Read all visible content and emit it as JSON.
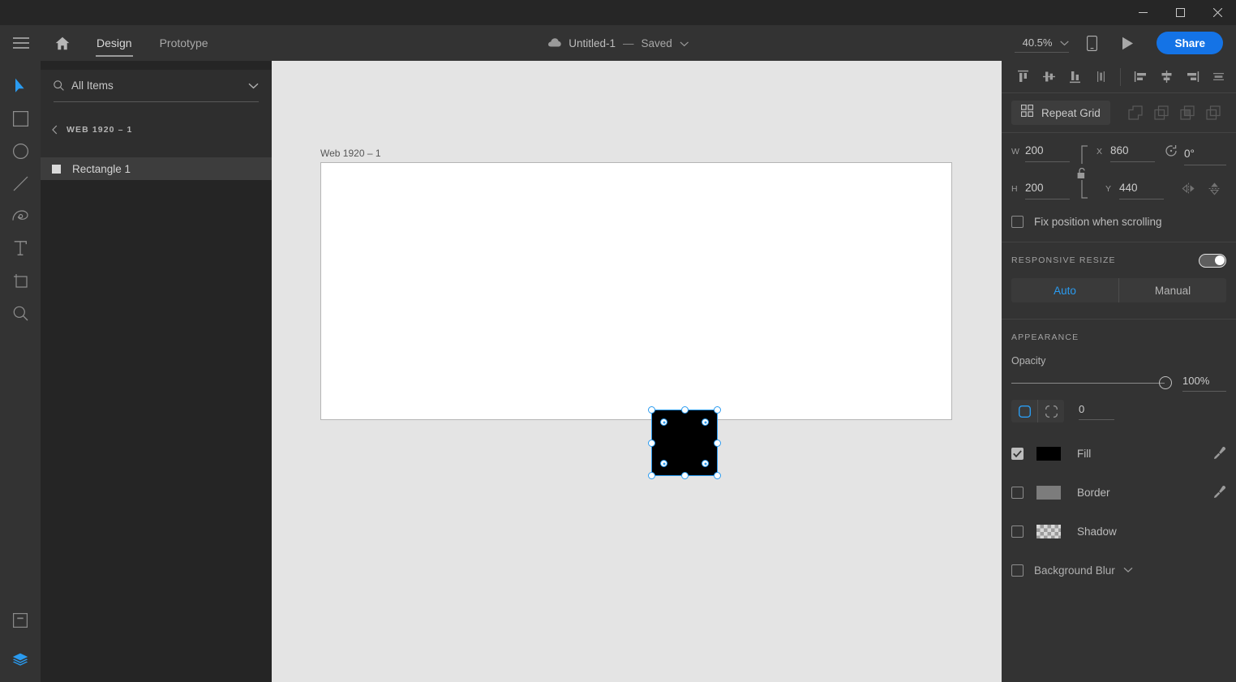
{
  "window": {
    "minimize_label": "Minimize",
    "maximize_label": "Maximize",
    "close_label": "Close"
  },
  "appbar": {
    "menu_label": "Menu",
    "home_label": "Home",
    "tabs": [
      {
        "label": "Design",
        "active": true
      },
      {
        "label": "Prototype",
        "active": false
      }
    ],
    "document": {
      "name": "Untitled-1",
      "separator": "—",
      "status": "Saved"
    },
    "zoom": "40.5%",
    "preview_label": "Preview on device",
    "play_label": "Desktop preview",
    "share_label": "Share"
  },
  "toolbar": {
    "tools": [
      {
        "name": "select-tool",
        "label": "Select",
        "active": true
      },
      {
        "name": "rectangle-tool",
        "label": "Rectangle",
        "active": false
      },
      {
        "name": "ellipse-tool",
        "label": "Ellipse",
        "active": false
      },
      {
        "name": "line-tool",
        "label": "Line",
        "active": false
      },
      {
        "name": "pen-tool",
        "label": "Pen",
        "active": false
      },
      {
        "name": "text-tool",
        "label": "Text",
        "active": false
      },
      {
        "name": "artboard-tool",
        "label": "Artboard",
        "active": false
      },
      {
        "name": "zoom-tool",
        "label": "Zoom",
        "active": false
      }
    ],
    "components_label": "Assets",
    "layers_label": "Layers"
  },
  "layers": {
    "search_placeholder": "All Items",
    "search_value": "All Items",
    "group_label": "WEB 1920 – 1",
    "items": [
      {
        "name": "Rectangle 1",
        "selected": true
      }
    ]
  },
  "canvas": {
    "artboard_name": "Web 1920 – 1",
    "background": "#e4e4e4",
    "artboard_fill": "#ffffff",
    "shape_fill": "#000000",
    "selection_color": "#2a9bf0"
  },
  "properties": {
    "align": {
      "vertical": [
        "align-top",
        "align-middle",
        "align-bottom",
        "distribute-vertical"
      ],
      "horizontal": [
        "align-left",
        "align-center",
        "align-right",
        "distribute-horizontal"
      ]
    },
    "repeat_grid_label": "Repeat Grid",
    "boolean_ops": [
      "add",
      "subtract",
      "intersect",
      "exclude"
    ],
    "transform": {
      "w_label": "W",
      "w_value": "200",
      "h_label": "H",
      "h_value": "200",
      "x_label": "X",
      "x_value": "860",
      "y_label": "Y",
      "y_value": "440",
      "rotation_value": "0°",
      "flip_horizontal_label": "Flip horizontally",
      "flip_vertical_label": "Flip vertically",
      "lock_aspect_label": "Lock aspect ratio"
    },
    "fix_position_label": "Fix position when scrolling",
    "fix_position_checked": false,
    "responsive_resize": {
      "title": "RESPONSIVE RESIZE",
      "enabled": true,
      "options": [
        {
          "label": "Auto",
          "active": true
        },
        {
          "label": "Manual",
          "active": false
        }
      ]
    },
    "appearance": {
      "title": "APPEARANCE",
      "opacity_label": "Opacity",
      "opacity_value": "100%",
      "corner_radius_value": "0",
      "corner_mode": "uniform",
      "rows": [
        {
          "label": "Fill",
          "checked": true,
          "swatch": "#000000",
          "eyedropper": true
        },
        {
          "label": "Border",
          "checked": false,
          "swatch": "#7c7c7c",
          "eyedropper": true
        },
        {
          "label": "Shadow",
          "checked": false,
          "swatch": "checker",
          "eyedropper": false
        }
      ],
      "background_blur_label": "Background Blur",
      "background_blur_checked": false
    }
  },
  "colors": {
    "accent": "#1473e6",
    "selection": "#2a9bf0",
    "panel_bg": "#333333",
    "layers_bg": "#252525",
    "titlebar_bg": "#262626",
    "canvas_bg": "#e4e4e4"
  }
}
